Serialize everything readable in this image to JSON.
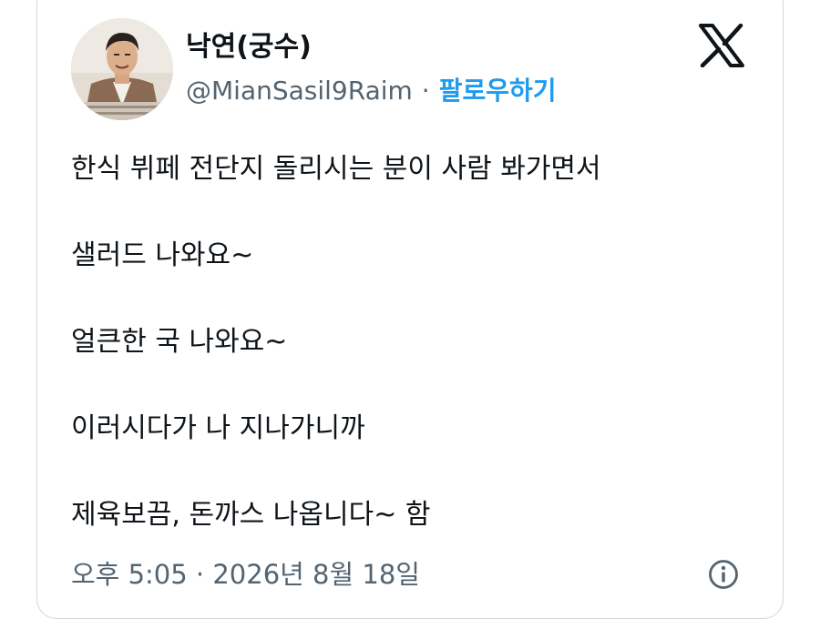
{
  "author": {
    "display_name": "낙연(궁수)",
    "handle": "@MianSasil9Raim",
    "separator": "·",
    "follow_label": "팔로우하기"
  },
  "icons": {
    "logo": "x-logo-icon",
    "info": "info-circle-icon"
  },
  "tweet": {
    "lines": [
      "한식 뷔페 전단지 돌리시는 분이 사람 봐가면서",
      "샐러드 나와요~",
      "얼큰한 국 나와요~",
      "이러시다가 나 지나가니까",
      "제육보끔, 돈까스 나옵니다~ 함"
    ]
  },
  "meta": {
    "time": "오후 5:05",
    "separator": "·",
    "date": "2026년 8월 18일"
  },
  "colors": {
    "text": "#0f1419",
    "secondary": "#536471",
    "accent": "#1d9bf0",
    "border": "#cfd9de"
  }
}
